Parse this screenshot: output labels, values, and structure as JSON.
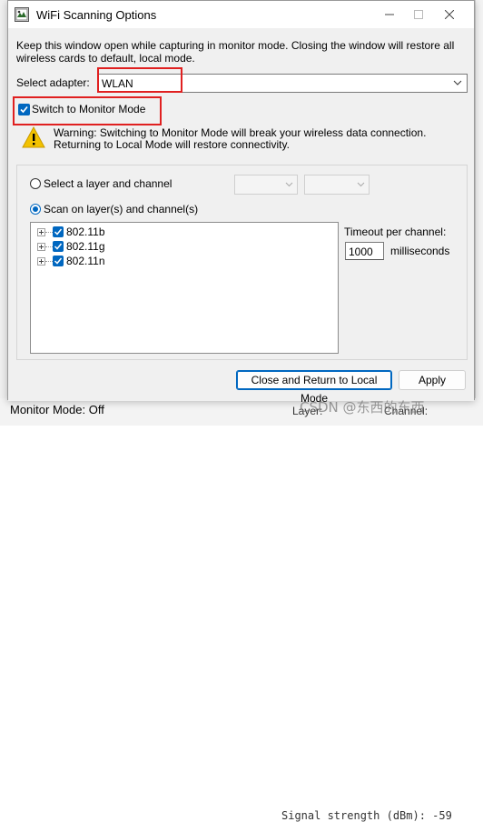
{
  "window": {
    "title": "WiFi Scanning Options",
    "icon": "wireshark-app-icon"
  },
  "intro_text": "Keep this window open while capturing in monitor mode. Closing the window will restore all wireless cards to default, local mode.",
  "adapter": {
    "label": "Select adapter:",
    "value": "WLAN"
  },
  "monitor_mode": {
    "label": "Switch to Monitor Mode",
    "checked": true
  },
  "warning_text": "Warning: Switching to Monitor Mode will break your wireless data connection. Returning to Local Mode will restore connectivity.",
  "scan_options": {
    "layer_channel_label": "Select a layer and channel",
    "scan_label": "Scan on layer(s) and channel(s)",
    "selected": "scan"
  },
  "layers": [
    {
      "label": "802.11b",
      "checked": true
    },
    {
      "label": "802.11g",
      "checked": true
    },
    {
      "label": "802.11n",
      "checked": true
    }
  ],
  "timeout": {
    "label": "Timeout per channel:",
    "value": "1000",
    "unit": "milliseconds"
  },
  "buttons": {
    "close_return": "Close and Return to Local Mode",
    "apply": "Apply"
  },
  "status": {
    "monitor_mode": "Monitor Mode: Off",
    "layer": "Layer:",
    "channel": "Channel:"
  },
  "background": {
    "signal_text": "Signal strength (dBm): -59"
  },
  "watermark": "CSDN @东西的东西",
  "colors": {
    "accent": "#0067c0",
    "highlight": "#e02020",
    "warning": "#f2c200"
  }
}
